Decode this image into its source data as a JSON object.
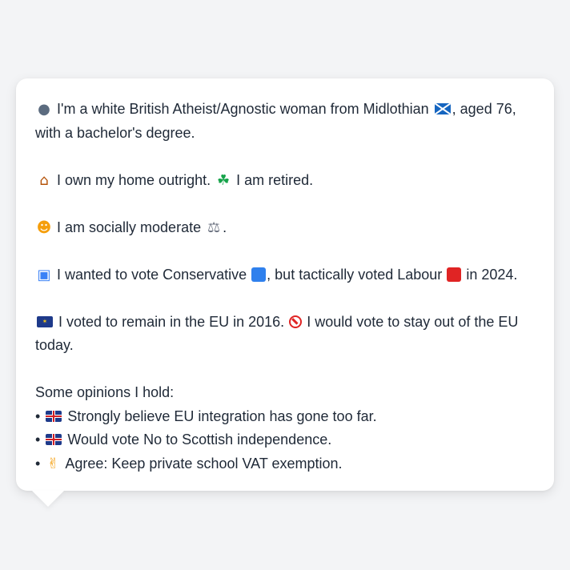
{
  "card": {
    "identity": {
      "icon": "person-silhouette-icon",
      "text_a": "I'm a white British Atheist/Agnostic woman from Midlothian",
      "flag": "scotland-flag-icon",
      "text_b": ", aged 76, with a bachelor's degree."
    },
    "home": {
      "icon": "house-icon",
      "text_a": "I own my home outright.",
      "icon2": "palm-tree-icon",
      "text_b": "I am retired."
    },
    "social": {
      "icon": "thinking-face-icon",
      "text_a": "I am socially moderate",
      "icon2": "balance-scale-icon",
      "text_b": "."
    },
    "vote": {
      "icon": "ballot-box-icon",
      "text_a": "I wanted to vote Conservative",
      "square1_color": "#2f80ed",
      "text_b": ", but tactically voted Labour",
      "square2_color": "#e02424",
      "text_c": "in 2024."
    },
    "eu": {
      "icon": "eu-flag-icon",
      "text_a": "I voted to remain in the EU in 2016.",
      "icon2": "prohibited-icon",
      "text_b": "I would vote to stay out of the EU today."
    },
    "opinions": {
      "heading": "Some opinions I hold:",
      "bullet": "•",
      "items": [
        {
          "icon": "uk-flag-icon",
          "text": "Strongly believe EU integration has gone too far."
        },
        {
          "icon": "uk-flag-icon",
          "text": "Would vote No to Scottish independence."
        },
        {
          "icon": "thumbs-up-icon",
          "text": "Agree: Keep private school VAT exemption."
        }
      ]
    }
  },
  "colors": {
    "background": "#f3f4f6",
    "card": "#ffffff",
    "text": "#1f2937"
  }
}
